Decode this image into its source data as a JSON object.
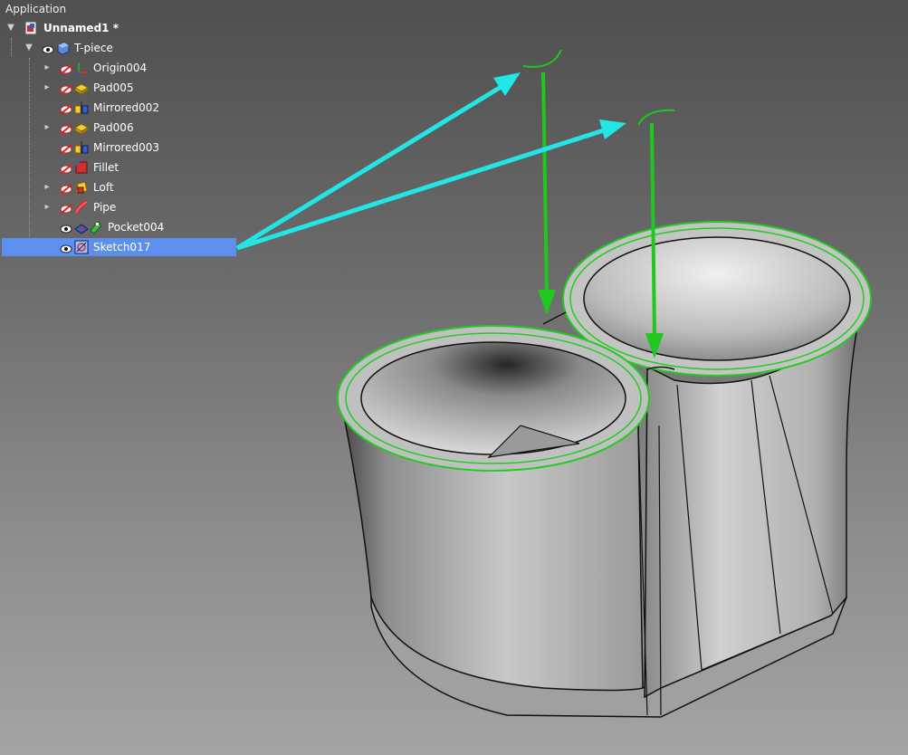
{
  "tree": {
    "header": "Application",
    "document": {
      "label": "Unnamed1 *"
    },
    "body": {
      "label": "T-piece"
    },
    "features": [
      {
        "label": "Origin004",
        "icon": "origin-icon",
        "expandable": true
      },
      {
        "label": "Pad005",
        "icon": "pad-icon",
        "expandable": true
      },
      {
        "label": "Mirrored002",
        "icon": "mirrored-icon",
        "expandable": false
      },
      {
        "label": "Pad006",
        "icon": "pad-icon",
        "expandable": true
      },
      {
        "label": "Mirrored003",
        "icon": "mirrored-icon",
        "expandable": false
      },
      {
        "label": "Fillet",
        "icon": "fillet-icon",
        "expandable": false
      },
      {
        "label": "Loft",
        "icon": "loft-icon",
        "expandable": true
      },
      {
        "label": "Pipe",
        "icon": "pipe-icon",
        "expandable": true
      },
      {
        "label": "Pocket004",
        "icon": "pocket-icon",
        "expandable": false
      },
      {
        "label": "Sketch017",
        "icon": "sketch-icon",
        "expandable": false,
        "selected": true
      }
    ]
  },
  "colors": {
    "selection": "#5c8ff0",
    "cyan_arrow": "#22e6e6",
    "green_arrow": "#1ec81e",
    "edge_highlight": "#22cc22"
  }
}
